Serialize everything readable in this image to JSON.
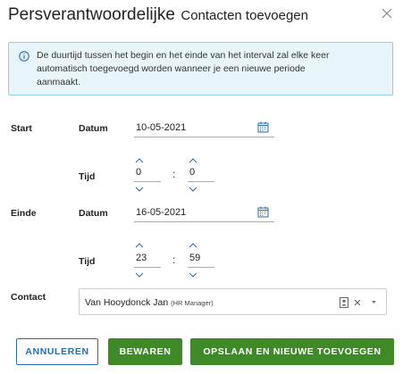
{
  "dialog": {
    "title": "Persverantwoordelijke",
    "subtitle": "Contacten toevoegen"
  },
  "info": {
    "line1": "De duurtijd tussen het begin en het einde van het interval zal elke keer",
    "line2": "automatisch toegevoegd worden wanneer je een nieuwe periode",
    "line3": "aanmaakt."
  },
  "start": {
    "label": "Start",
    "date_label": "Datum",
    "date_value": "10-05-2021",
    "time_label": "Tijd",
    "hour": "0",
    "minute": "0"
  },
  "end": {
    "label": "Einde",
    "date_label": "Datum",
    "date_value": "16-05-2021",
    "time_label": "Tijd",
    "hour": "23",
    "minute": "59"
  },
  "time_separator": ":",
  "contact": {
    "label": "Contact",
    "name": "Van Hooydonck Jan",
    "role": "(HR Manager)"
  },
  "buttons": {
    "cancel": "ANNULEREN",
    "save": "BEWAREN",
    "save_new": "OPSLAAN EN NIEUWE TOEVOEGEN"
  },
  "colors": {
    "accent_blue": "#2a6db0",
    "primary_green": "#3d8a27",
    "info_bg": "#e8f5fb",
    "info_border": "#8fcde9"
  },
  "icons": [
    "close-icon",
    "info-icon",
    "calendar-icon",
    "chevron-up-icon",
    "chevron-down-icon",
    "contact-card-icon",
    "clear-icon",
    "caret-down-icon"
  ]
}
